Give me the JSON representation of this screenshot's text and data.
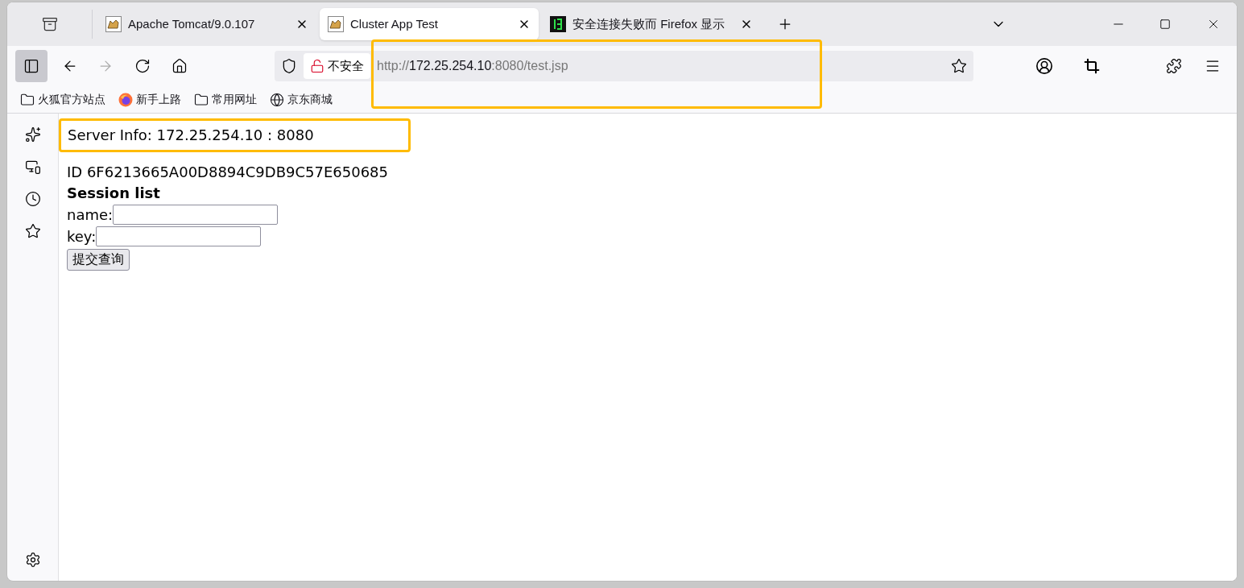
{
  "tabs": [
    {
      "title": "Apache Tomcat/9.0.107",
      "selected": false
    },
    {
      "title": "Cluster App Test",
      "selected": true
    },
    {
      "title": "安全连接失败而 Firefox 显示",
      "selected": false
    }
  ],
  "address": {
    "security": "不安全",
    "prefix": "http://",
    "host": "172.25.254.10",
    "rest": ":8080/test.jsp"
  },
  "bookmarks": [
    {
      "label": "火狐官方站点"
    },
    {
      "label": "新手上路"
    },
    {
      "label": "常用网址"
    },
    {
      "label": "京东商城"
    }
  ],
  "page": {
    "server_info": "Server Info: 172.25.254.10 : 8080",
    "session_id": "ID 6F6213665A00D8894C9DB9C57E650685",
    "heading": "Session list",
    "fields": [
      {
        "label": "name:"
      },
      {
        "label": "key:"
      }
    ],
    "submit": "提交查询"
  }
}
